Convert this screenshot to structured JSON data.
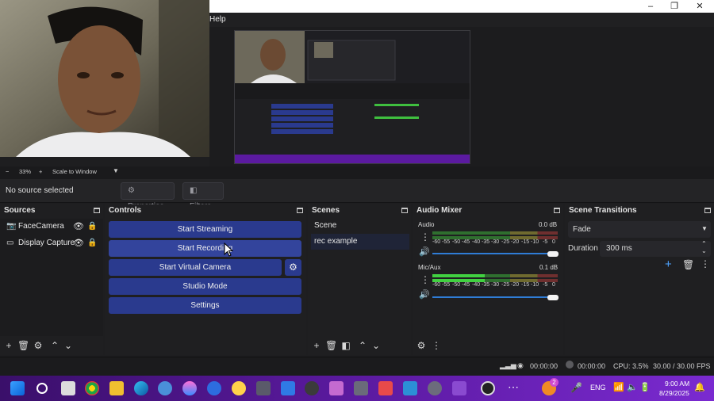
{
  "window": {
    "menu_help": "Help"
  },
  "zoom": {
    "minus": "−",
    "level": "33%",
    "plus": "+",
    "mode": "Scale to Window"
  },
  "source_toolbar": {
    "status": "No source selected",
    "properties": "Properties",
    "filters": "Filters"
  },
  "sources": {
    "title": "Sources",
    "items": [
      {
        "label": "FaceCamera",
        "icon": "camera-icon"
      },
      {
        "label": "Display Capture",
        "icon": "monitor-icon"
      }
    ]
  },
  "controls": {
    "title": "Controls",
    "buttons": [
      "Start Streaming",
      "Start Recording",
      "Start Virtual Camera",
      "Studio Mode",
      "Settings"
    ]
  },
  "scenes": {
    "title": "Scenes",
    "items": [
      "Scene",
      "rec example"
    ],
    "selected": 1
  },
  "audio_mixer": {
    "title": "Audio Mixer",
    "channels": [
      {
        "name": "Audio",
        "db": "0.0 dB",
        "level": 0.0
      },
      {
        "name": "Mic/Aux",
        "db": "0.1 dB",
        "level": 0.42
      }
    ],
    "scale": [
      "-60",
      "-55",
      "-50",
      "-45",
      "-40",
      "-35",
      "-30",
      "-25",
      "-20",
      "-15",
      "-10",
      "-5",
      "0"
    ]
  },
  "transitions": {
    "title": "Scene Transitions",
    "type": "Fade",
    "duration_label": "Duration",
    "duration": "300 ms"
  },
  "status": {
    "stream_time": "00:00:00",
    "rec_time": "00:00:00",
    "cpu": "CPU: 3.5%",
    "fps": "30.00 / 30.00 FPS"
  },
  "taskbar": {
    "lang": "ENG",
    "time": "9:00 AM",
    "date": "8/29/2025",
    "badge": "2"
  },
  "colors": {
    "accent": "#2a3a8e",
    "taskbar": "#5b1aa0"
  }
}
